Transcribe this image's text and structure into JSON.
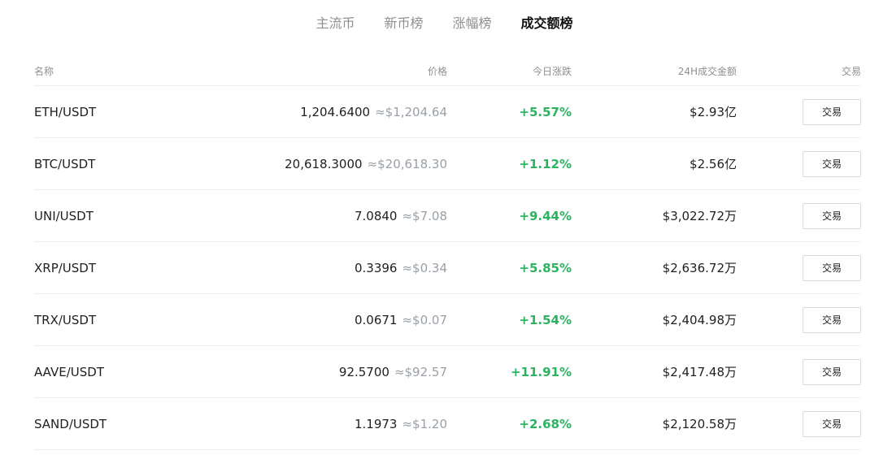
{
  "tabs": [
    {
      "label": "主流币",
      "active": false
    },
    {
      "label": "新币榜",
      "active": false
    },
    {
      "label": "涨幅榜",
      "active": false
    },
    {
      "label": "成交额榜",
      "active": true
    }
  ],
  "table": {
    "headers": {
      "name": "名称",
      "price": "价格",
      "change": "今日涨跌",
      "volume": "24H成交金额",
      "trade": "交易"
    },
    "rows": [
      {
        "pair": "ETH/USDT",
        "price": "1,204.6400",
        "usd": "≈$1,204.64",
        "change": "+5.57%",
        "volume": "$2.93亿",
        "trade": "交易"
      },
      {
        "pair": "BTC/USDT",
        "price": "20,618.3000",
        "usd": "≈$20,618.30",
        "change": "+1.12%",
        "volume": "$2.56亿",
        "trade": "交易"
      },
      {
        "pair": "UNI/USDT",
        "price": "7.0840",
        "usd": "≈$7.08",
        "change": "+9.44%",
        "volume": "$3,022.72万",
        "trade": "交易"
      },
      {
        "pair": "XRP/USDT",
        "price": "0.3396",
        "usd": "≈$0.34",
        "change": "+5.85%",
        "volume": "$2,636.72万",
        "trade": "交易"
      },
      {
        "pair": "TRX/USDT",
        "price": "0.0671",
        "usd": "≈$0.07",
        "change": "+1.54%",
        "volume": "$2,404.98万",
        "trade": "交易"
      },
      {
        "pair": "AAVE/USDT",
        "price": "92.5700",
        "usd": "≈$92.57",
        "change": "+11.91%",
        "volume": "$2,417.48万",
        "trade": "交易"
      },
      {
        "pair": "SAND/USDT",
        "price": "1.1973",
        "usd": "≈$1.20",
        "change": "+2.68%",
        "volume": "$2,120.58万",
        "trade": "交易"
      }
    ]
  },
  "colors": {
    "positive": "#2bb360",
    "muted": "#8f8f8f"
  }
}
